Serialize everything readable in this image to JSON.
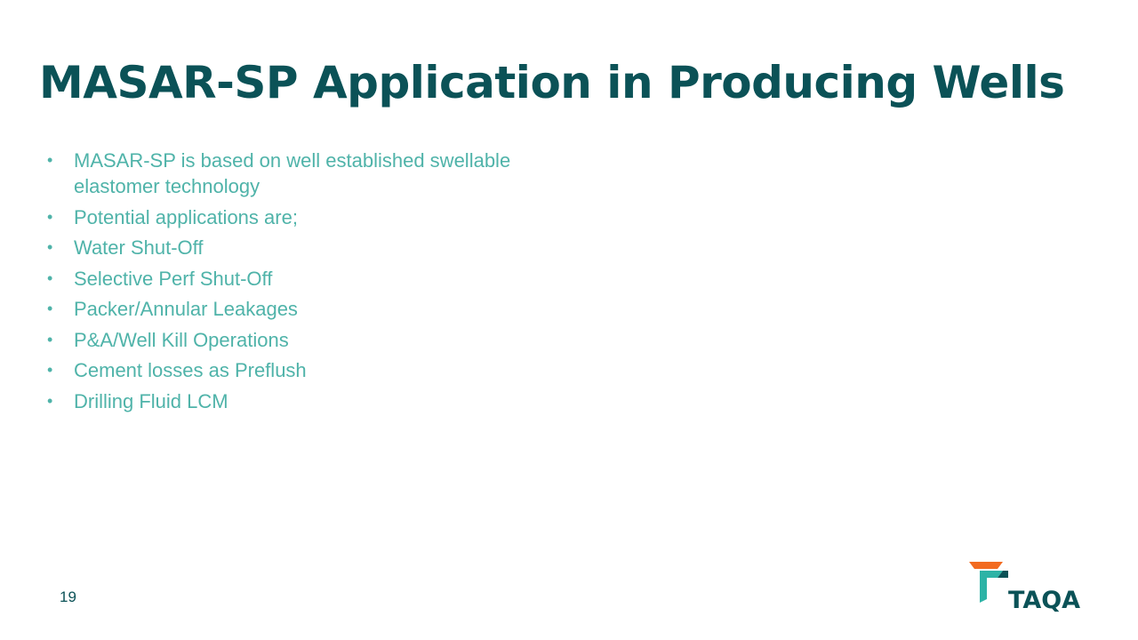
{
  "slide": {
    "title": "MASAR-SP Application in Producing Wells",
    "bullets": [
      "MASAR-SP is based on well established swellable elastomer technology",
      "Potential applications are;",
      "Water Shut-Off",
      "Selective Perf Shut-Off",
      "Packer/Annular Leakages",
      "P&A/Well Kill Operations",
      "Cement losses as Preflush",
      "Drilling Fluid LCM"
    ],
    "bullet_symbol": "•",
    "page_number": "19"
  },
  "logo": {
    "text": "TAQA",
    "icon": "taqa-logo-icon",
    "colors": {
      "orange": "#f26b21",
      "teal": "#2db3a6",
      "dark": "#0b5257"
    }
  },
  "colors": {
    "title": "#0b5257",
    "body_text": "#4fb3a9",
    "background": "#ffffff"
  }
}
